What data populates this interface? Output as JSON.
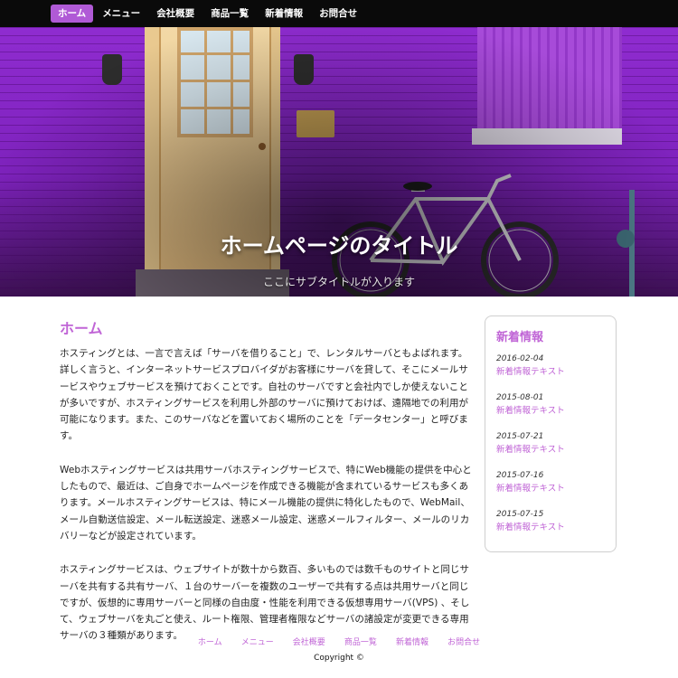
{
  "nav": {
    "items": [
      {
        "label": "ホーム",
        "active": true
      },
      {
        "label": "メニュー",
        "active": false
      },
      {
        "label": "会社概要",
        "active": false
      },
      {
        "label": "商品一覧",
        "active": false
      },
      {
        "label": "新着情報",
        "active": false
      },
      {
        "label": "お問合せ",
        "active": false
      }
    ]
  },
  "hero": {
    "title": "ホームページのタイトル",
    "subtitle": "ここにサブタイトルが入ります"
  },
  "main": {
    "heading": "ホーム",
    "paragraphs": [
      "ホスティングとは、一言で言えば「サーバを借りること」で、レンタルサーバともよばれます。詳しく言うと、インターネットサービスプロバイダがお客様にサーバを貸して、そこにメールサービスやウェブサービスを預けておくことです。自社のサーバですと会社内でしか使えないことが多いですが、ホスティングサービスを利用し外部のサーバに預けておけば、遠隔地での利用が可能になります。また、このサーバなどを置いておく場所のことを「データセンター」と呼びます。",
      "Webホスティングサービスは共用サーバホスティングサービスで、特にWeb機能の提供を中心としたもので、最近は、ご自身でホームページを作成できる機能が含まれているサービスも多くあります。メールホスティングサービスは、特にメール機能の提供に特化したもので、WebMail、メール自動送信設定、メール転送設定、迷惑メール設定、迷惑メールフィルター、メールのリカバリーなどが設定されています。",
      "ホスティングサービスは、ウェブサイトが数十から数百、多いものでは数千ものサイトと同じサーバを共有する共有サーバ、１台のサーバーを複数のユーザーで共有する点は共用サーバと同じですが、仮想的に専用サーバーと同様の自由度・性能を利用できる仮想専用サーバ(VPS) 、そして、ウェブサーバを丸ごと使え、ルート権限、管理者権限などサーバの諸設定が変更できる専用サーバの３種類があります。"
    ]
  },
  "sidebar": {
    "heading": "新着情報",
    "news": [
      {
        "date": "2016-02-04",
        "link": "新着情報テキスト"
      },
      {
        "date": "2015-08-01",
        "link": "新着情報テキスト"
      },
      {
        "date": "2015-07-21",
        "link": "新着情報テキスト"
      },
      {
        "date": "2015-07-16",
        "link": "新着情報テキスト"
      },
      {
        "date": "2015-07-15",
        "link": "新着情報テキスト"
      }
    ]
  },
  "footer": {
    "links": [
      "ホーム",
      "メニュー",
      "会社概要",
      "商品一覧",
      "新着情報",
      "お問合せ"
    ],
    "copyright": "Copyright ©"
  },
  "colors": {
    "accent": "#c065d6",
    "nav_active": "#b05ad6",
    "nav_bg": "#0a0a0a"
  }
}
